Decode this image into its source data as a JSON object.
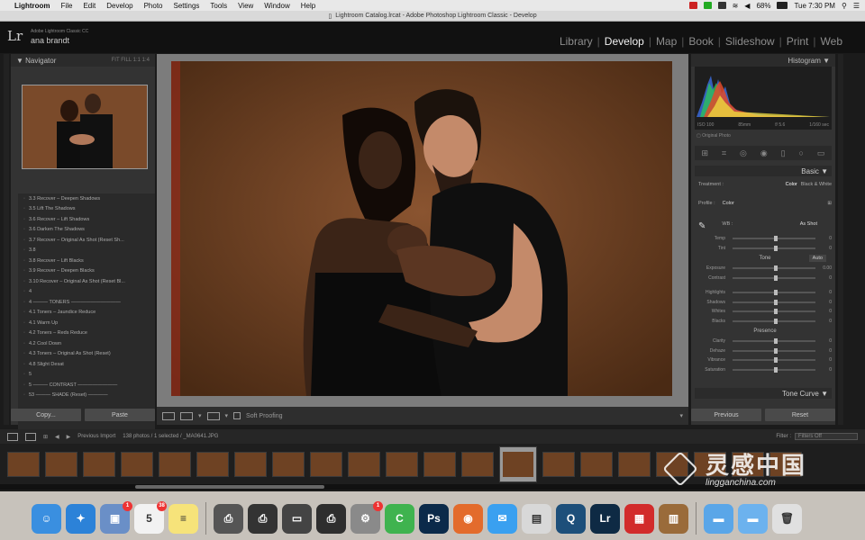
{
  "menubar": {
    "app": "Lightroom",
    "items": [
      "File",
      "Edit",
      "Develop",
      "Photo",
      "Settings",
      "Tools",
      "View",
      "Window",
      "Help"
    ],
    "battery": "68%",
    "clock": "Tue 7:30 PM"
  },
  "window": {
    "title": "Lightroom Catalog.lrcat - Adobe Photoshop Lightroom Classic - Develop"
  },
  "header": {
    "logo": "Lr",
    "version": "Adobe Lightroom Classic CC",
    "user": "ana brandt",
    "modules": [
      "Library",
      "Develop",
      "Map",
      "Book",
      "Slideshow",
      "Print",
      "Web"
    ],
    "active_module": "Develop"
  },
  "left": {
    "navigator_title": "Navigator",
    "navigator_opts": "FIT  FILL  1:1  1:4",
    "history": [
      "3.3    Recover – Deepen Shadows",
      "3.5  Lift The Shadows",
      "3.6    Recover – Lift Shadows",
      "3.6  Darken The Shadows",
      "3.7    Recover – Original As Shot (Reset Sh...",
      "3.8",
      "3.8    Recover – Lift Blacks",
      "3.9    Recover – Deepen Blacks",
      "3.10  Recover – Original As Shot (Reset Bl...",
      "4",
      "4 ——— TONERS ——————————",
      "4.1    Toners – Jaundice Reduce",
      "4.1  Warm Up",
      "4.2    Toners – Reds Reduce",
      "4.2  Cool Down",
      "4.3    Toners – Original As Shot (Reset)",
      "4.8  Slight Desat",
      "5",
      "5 ——— CONTRAST ————————",
      "53 ——— SHADE (Reset) ————"
    ],
    "copy": "Copy...",
    "paste": "Paste"
  },
  "toolbar": {
    "soft_proofing": "Soft Proofing"
  },
  "right": {
    "histogram_title": "Histogram",
    "histo_meta": [
      "ISO 100",
      "85mm",
      "f/ 5.6",
      "1/160 sec"
    ],
    "original_photo": "Original Photo",
    "basic_title": "Basic",
    "treatment_label": "Treatment :",
    "treatment_color": "Color",
    "treatment_bw": "Black & White",
    "profile_label": "Profile :",
    "profile_value": "Color",
    "wb_label": "WB :",
    "wb_value": "As Shot",
    "wb_sliders": [
      {
        "label": "Temp",
        "value": "0",
        "pos": 0.5
      },
      {
        "label": "Tint",
        "value": "0",
        "pos": 0.5
      }
    ],
    "tone_title": "Tone",
    "auto": "Auto",
    "tone_sliders": [
      {
        "label": "Exposure",
        "value": "0.00",
        "pos": 0.5
      },
      {
        "label": "Contrast",
        "value": "0",
        "pos": 0.5
      },
      {
        "label": "Highlights",
        "value": "0",
        "pos": 0.5
      },
      {
        "label": "Shadows",
        "value": "0",
        "pos": 0.5
      },
      {
        "label": "Whites",
        "value": "0",
        "pos": 0.5
      },
      {
        "label": "Blacks",
        "value": "0",
        "pos": 0.5
      }
    ],
    "presence_title": "Presence",
    "presence_sliders": [
      {
        "label": "Clarity",
        "value": "0",
        "pos": 0.5
      },
      {
        "label": "Dehaze",
        "value": "0",
        "pos": 0.5
      },
      {
        "label": "Vibrance",
        "value": "0",
        "pos": 0.5
      },
      {
        "label": "Saturation",
        "value": "0",
        "pos": 0.5
      }
    ],
    "tonecurve_title": "Tone Curve",
    "previous": "Previous",
    "reset": "Reset"
  },
  "filmbar": {
    "source": "Previous Import",
    "count": "138 photos / 1 selected / _MA0641.JPG",
    "filter_label": "Filter :",
    "filter_value": "Filters Off"
  },
  "dock": {
    "icons": [
      {
        "name": "finder-icon",
        "color": "#3a8fe0",
        "glyph": "☺"
      },
      {
        "name": "safari-icon",
        "color": "#2c82d8",
        "glyph": "✦"
      },
      {
        "name": "preview-icon",
        "color": "#6a8fc7",
        "glyph": "▣",
        "badge": "1"
      },
      {
        "name": "calendar-icon",
        "color": "#f2f2f2",
        "glyph": "5",
        "badge": "38"
      },
      {
        "name": "notes-icon",
        "color": "#f6e37a",
        "glyph": "≡"
      },
      {
        "name": "printer-icon",
        "color": "#555555",
        "glyph": "⎙"
      },
      {
        "name": "printer2-icon",
        "color": "#333333",
        "glyph": "⎙"
      },
      {
        "name": "monitor-icon",
        "color": "#444444",
        "glyph": "▭"
      },
      {
        "name": "printer3-icon",
        "color": "#2e2e2e",
        "glyph": "⎙"
      },
      {
        "name": "system-preferences-icon",
        "color": "#8a8a8a",
        "glyph": "⚙",
        "badge": "1"
      },
      {
        "name": "camtasia-icon",
        "color": "#3fb34f",
        "glyph": "C"
      },
      {
        "name": "photoshop-icon",
        "color": "#0b2a4a",
        "glyph": "Ps"
      },
      {
        "name": "camera-app-icon",
        "color": "#e36b2c",
        "glyph": "◉"
      },
      {
        "name": "messages-icon",
        "color": "#3aa0f0",
        "glyph": "✉"
      },
      {
        "name": "preview2-icon",
        "color": "#d8d8d8",
        "glyph": "▤"
      },
      {
        "name": "quicktime-icon",
        "color": "#1d4f7a",
        "glyph": "Q"
      },
      {
        "name": "lightroom-icon",
        "color": "#0e2a44",
        "glyph": "Lr"
      },
      {
        "name": "fantastical-icon",
        "color": "#d22b2b",
        "glyph": "▦"
      },
      {
        "name": "archive-icon",
        "color": "#9a6b3a",
        "glyph": "▥"
      },
      {
        "name": "folder-icon",
        "color": "#5aa6e8",
        "glyph": "▬"
      },
      {
        "name": "downloads-folder-icon",
        "color": "#6cb2ee",
        "glyph": "▬"
      },
      {
        "name": "trash-icon",
        "color": "#e0e0e0",
        "glyph": "🗑"
      }
    ]
  },
  "watermark": {
    "cn": "灵感中国",
    "url": "lingganchina.com"
  },
  "colors": {
    "accent": "#f0f0f0",
    "backdrop": "#6b3f1f"
  }
}
